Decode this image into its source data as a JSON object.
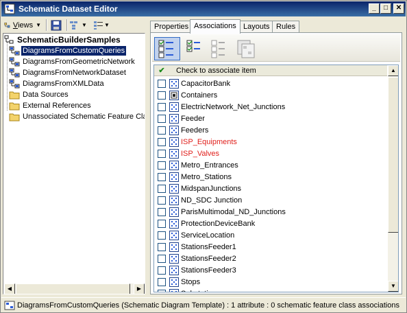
{
  "window": {
    "title": "Schematic Dataset Editor"
  },
  "toolbar": {
    "views_label": "Views",
    "views_underline": "V",
    "views_rest": "iews"
  },
  "tree": {
    "root": "SchematicBuilderSamples",
    "items": [
      {
        "label": "DiagramsFromCustomQueries",
        "icon": "diagram-template-icon",
        "selected": true
      },
      {
        "label": "DiagramsFromGeometricNetwork",
        "icon": "diagram-template-icon"
      },
      {
        "label": "DiagramsFromNetworkDataset",
        "icon": "diagram-template-icon"
      },
      {
        "label": "DiagramsFromXMLData",
        "icon": "diagram-template-icon"
      },
      {
        "label": "Data Sources",
        "icon": "folder-icon"
      },
      {
        "label": "External References",
        "icon": "folder-icon"
      },
      {
        "label": "Unassociated Schematic Feature Clas",
        "icon": "folder-icon"
      }
    ]
  },
  "tabs": [
    {
      "label": "Properties"
    },
    {
      "label": "Associations",
      "active": true
    },
    {
      "label": "Layouts"
    },
    {
      "label": "Rules"
    }
  ],
  "associations": {
    "header": "Check to associate item",
    "items": [
      {
        "name": "CapacitorBank",
        "checked": false,
        "icon": "feature-class-icon"
      },
      {
        "name": "Containers",
        "checked": false,
        "icon": "container-icon"
      },
      {
        "name": "ElectricNetwork_Net_Junctions",
        "checked": false,
        "icon": "feature-class-icon"
      },
      {
        "name": "Feeder",
        "checked": false,
        "icon": "feature-class-icon"
      },
      {
        "name": "Feeders",
        "checked": false,
        "icon": "feature-class-icon"
      },
      {
        "name": "ISP_Equipments",
        "checked": false,
        "icon": "feature-class-icon",
        "color": "#e0201c"
      },
      {
        "name": "ISP_Valves",
        "checked": false,
        "icon": "feature-class-icon",
        "color": "#e0201c"
      },
      {
        "name": "Metro_Entrances",
        "checked": false,
        "icon": "feature-class-icon"
      },
      {
        "name": "Metro_Stations",
        "checked": false,
        "icon": "feature-class-icon"
      },
      {
        "name": "MidspanJunctions",
        "checked": false,
        "icon": "feature-class-icon"
      },
      {
        "name": "ND_SDC Junction",
        "checked": false,
        "icon": "feature-class-icon"
      },
      {
        "name": "ParisMultimodal_ND_Junctions",
        "checked": false,
        "icon": "feature-class-icon"
      },
      {
        "name": "ProtectionDeviceBank",
        "checked": false,
        "icon": "feature-class-icon"
      },
      {
        "name": "ServiceLocation",
        "checked": false,
        "icon": "feature-class-icon"
      },
      {
        "name": "StationsFeeder1",
        "checked": false,
        "icon": "feature-class-icon"
      },
      {
        "name": "StationsFeeder2",
        "checked": false,
        "icon": "feature-class-icon"
      },
      {
        "name": "StationsFeeder3",
        "checked": false,
        "icon": "feature-class-icon"
      },
      {
        "name": "Stops",
        "checked": false,
        "icon": "feature-class-icon"
      },
      {
        "name": "Substations",
        "checked": false,
        "icon": "feature-class-icon"
      }
    ]
  },
  "status": {
    "text": "DiagramsFromCustomQueries (Schematic Diagram Template) : 1 attribute : 0 schematic feature class associations"
  },
  "colors": {
    "title_start": "#0a246a",
    "title_end": "#3a6ea5",
    "selection": "#0a246a",
    "red_item": "#e0201c"
  }
}
